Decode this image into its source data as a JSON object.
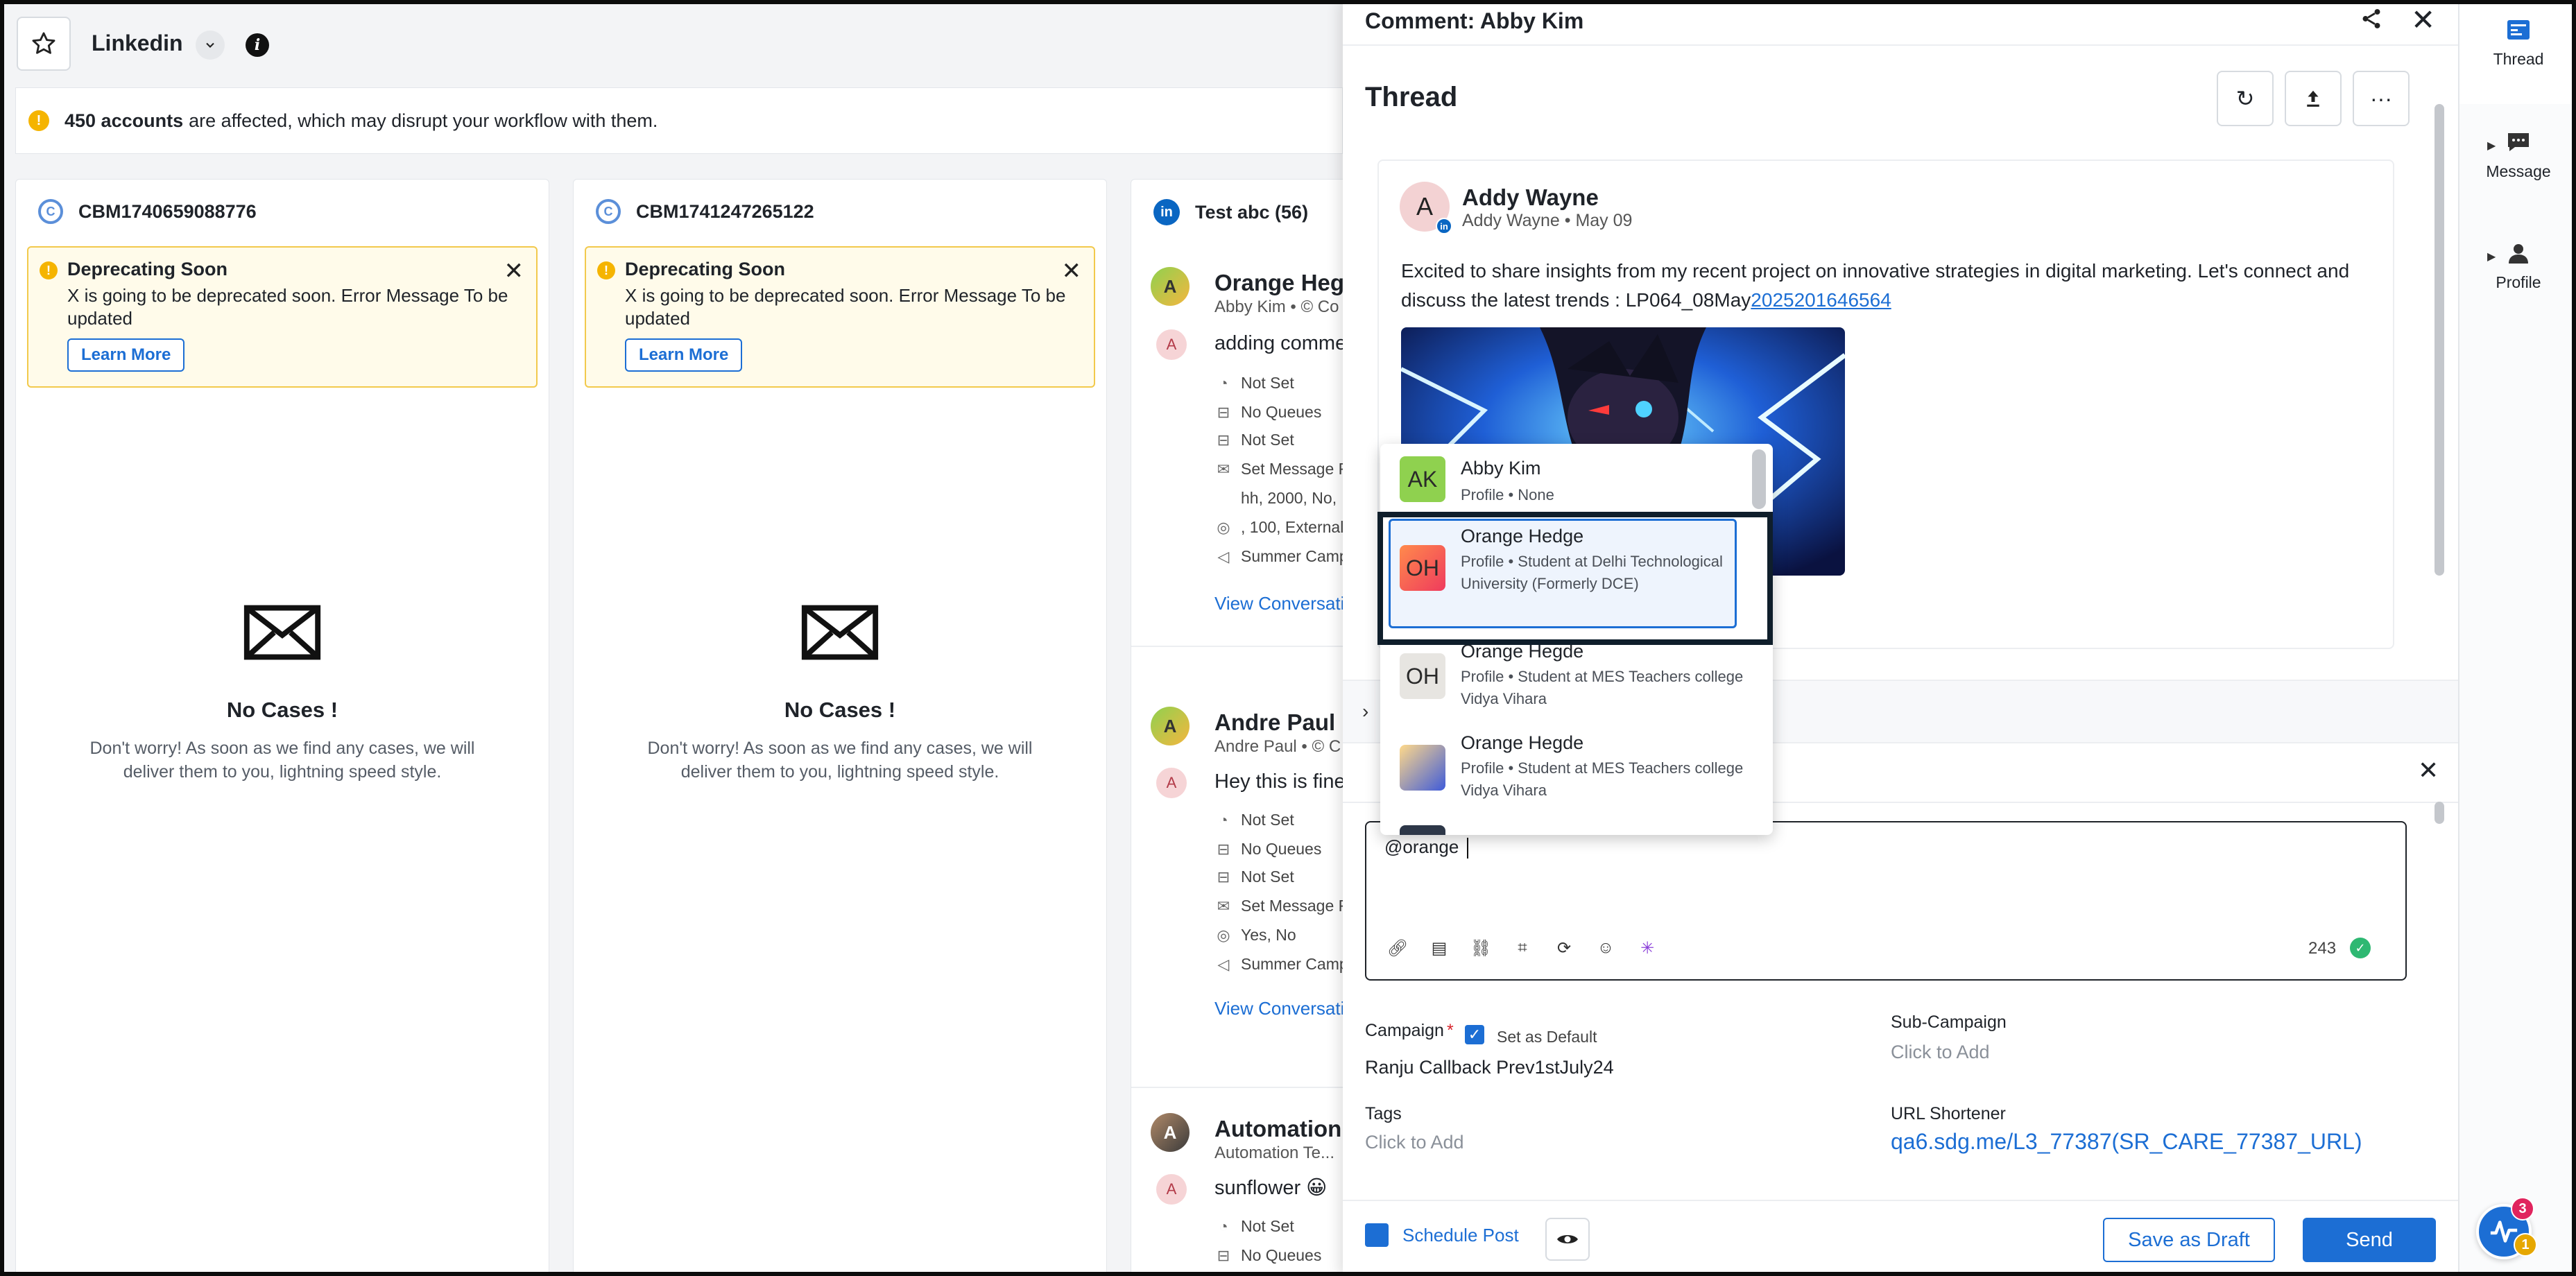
{
  "app": {
    "title": "Linkedin"
  },
  "banner": {
    "count_text": "450 accounts",
    "message": "are affected, which may disrupt your workflow with them."
  },
  "columns": [
    {
      "title": "CBM1740659088776",
      "deprecation": {
        "title": "Deprecating Soon",
        "message": "X is going to be deprecated soon. Error Message To be updated",
        "button": "Learn More"
      },
      "empty": {
        "title": "No Cases !",
        "message": "Don't worry! As soon as we find any cases, we will deliver them to you, lightning speed style."
      }
    },
    {
      "title": "CBM1741247265122",
      "deprecation": {
        "title": "Deprecating Soon",
        "message": "X is going to be deprecated soon. Error Message To be updated",
        "button": "Learn More"
      },
      "empty": {
        "title": "No Cases !",
        "message": "Don't worry! As soon as we find any cases, we will deliver them to you, lightning speed style."
      }
    }
  ],
  "conversations_column": {
    "title": "Test abc (56)",
    "items": [
      {
        "name": "Orange Heg",
        "sub": "Abby Kim • © Co",
        "avatar_initial": "A",
        "message": "adding comme",
        "meta": [
          "Not Set",
          "No Queues",
          "Not Set",
          "Set Message R",
          "hh, 2000, No,",
          ", 100, External",
          "Summer Camp"
        ],
        "link": "View Conversati"
      },
      {
        "name": "Andre Paul",
        "sub": "Andre Paul • © C",
        "avatar_initial": "A",
        "message": "Hey this is fine",
        "meta": [
          "Not Set",
          "No Queues",
          "Not Set",
          "Set Message R",
          "Yes, No",
          "Summer Camp"
        ],
        "link": "View Conversati"
      },
      {
        "name": "Automation",
        "sub": "Automation Te...",
        "avatar_initial": "A",
        "message": "sunflower 😀",
        "meta": [
          "Not Set",
          "No Queues"
        ]
      }
    ]
  },
  "panel": {
    "title": "Comment: Abby Kim",
    "thread_heading": "Thread",
    "post": {
      "avatar": "A",
      "author": "Addy Wayne",
      "sub": "Addy Wayne • May 09",
      "text": "Excited to share insights from my recent project on innovative strategies in digital marketing. Let's connect and discuss the latest trends : LP064_08May",
      "link": "2025201646564"
    },
    "composer": {
      "value": "@orange ",
      "char_count": "243"
    },
    "fields": {
      "campaign_label": "Campaign",
      "set_default": "Set as Default",
      "campaign_value": "Ranju Callback Prev1stJuly24",
      "sub_campaign_label": "Sub-Campaign",
      "sub_campaign_placeholder": "Click to Add",
      "tags_label": "Tags",
      "tags_placeholder": "Click to Add",
      "url_label": "URL Shortener",
      "url_value": "qa6.sdg.me/L3_77387(SR_CARE_77387_URL)"
    },
    "footer": {
      "schedule": "Schedule Post",
      "draft": "Save as Draft",
      "send": "Send"
    }
  },
  "mentions": [
    {
      "initials": "AK",
      "name": "Abby Kim",
      "desc": "Profile • None",
      "color": "#8fd14f"
    },
    {
      "initials": "OH",
      "name": "Orange Hedge",
      "desc": "Profile • Student at Delhi Technological University (Formerly DCE)",
      "color": "#f46b45"
    },
    {
      "initials": "OH",
      "name": "Orange Hegde",
      "desc": "Profile • Student at MES Teachers college Vidya Vihara",
      "color": "#e7e5e1"
    },
    {
      "initials": "",
      "name": "Orange Hegde",
      "desc": "Profile • Student at MES Teachers college Vidya Vihara",
      "color": "#f4c27a"
    }
  ],
  "rail": [
    {
      "label": "Thread"
    },
    {
      "label": "Message"
    },
    {
      "label": "Profile"
    }
  ],
  "fab": {
    "badge_red": "3",
    "badge_yellow": "1"
  }
}
